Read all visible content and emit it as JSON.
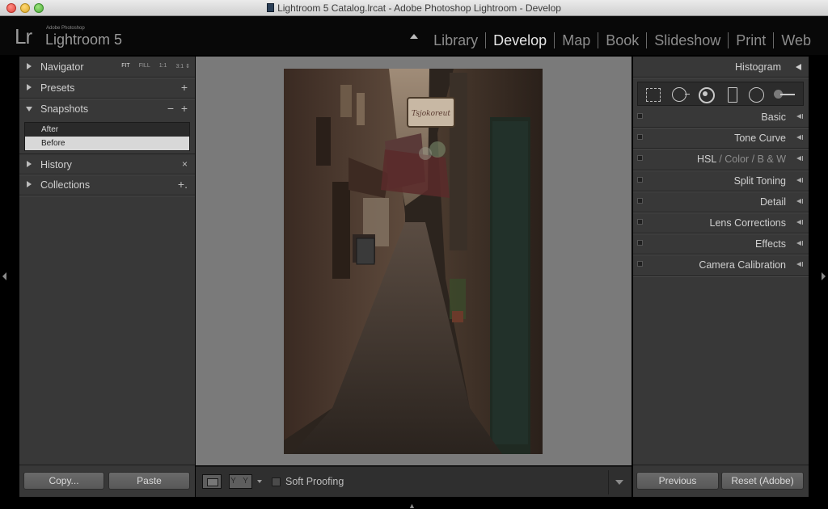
{
  "window": {
    "title": "Lightroom 5 Catalog.lrcat - Adobe Photoshop Lightroom - Develop"
  },
  "identity": {
    "logo": "Lr",
    "adobe": "Adobe Photoshop",
    "product": "Lightroom 5"
  },
  "modules": [
    "Library",
    "Develop",
    "Map",
    "Book",
    "Slideshow",
    "Print",
    "Web"
  ],
  "active_module": "Develop",
  "left_panel": {
    "navigator": {
      "title": "Navigator",
      "zoom": [
        "FIT",
        "FILL",
        "1:1",
        "3:1 ⇕"
      ]
    },
    "presets": {
      "title": "Presets",
      "action": "+"
    },
    "snapshots": {
      "title": "Snapshots",
      "remove": "−",
      "add": "+",
      "items": [
        "After",
        "Before"
      ],
      "selected": "Before"
    },
    "history": {
      "title": "History",
      "action": "×"
    },
    "collections": {
      "title": "Collections",
      "action": "+."
    },
    "copy_label": "Copy...",
    "paste_label": "Paste"
  },
  "toolbar": {
    "soft_proofing": "Soft Proofing",
    "view_yy": "Y Y"
  },
  "right_panel": {
    "histogram": "Histogram",
    "sections": [
      {
        "parts": [
          {
            "text": "Basic",
            "dim": false
          }
        ]
      },
      {
        "parts": [
          {
            "text": "Tone Curve",
            "dim": false
          }
        ]
      },
      {
        "parts": [
          {
            "text": "HSL",
            "dim": false
          },
          {
            "text": " / Color / ",
            "dim": true
          },
          {
            "text": "B & W",
            "dim": true
          }
        ]
      },
      {
        "parts": [
          {
            "text": "Split Toning",
            "dim": false
          }
        ]
      },
      {
        "parts": [
          {
            "text": "Detail",
            "dim": false
          }
        ]
      },
      {
        "parts": [
          {
            "text": "Lens Corrections",
            "dim": false
          }
        ]
      },
      {
        "parts": [
          {
            "text": "Effects",
            "dim": false
          }
        ]
      },
      {
        "parts": [
          {
            "text": "Camera Calibration",
            "dim": false
          }
        ]
      }
    ],
    "previous_label": "Previous",
    "reset_label": "Reset (Adobe)"
  },
  "photo": {
    "sign_text": "Tsjokoreut"
  }
}
